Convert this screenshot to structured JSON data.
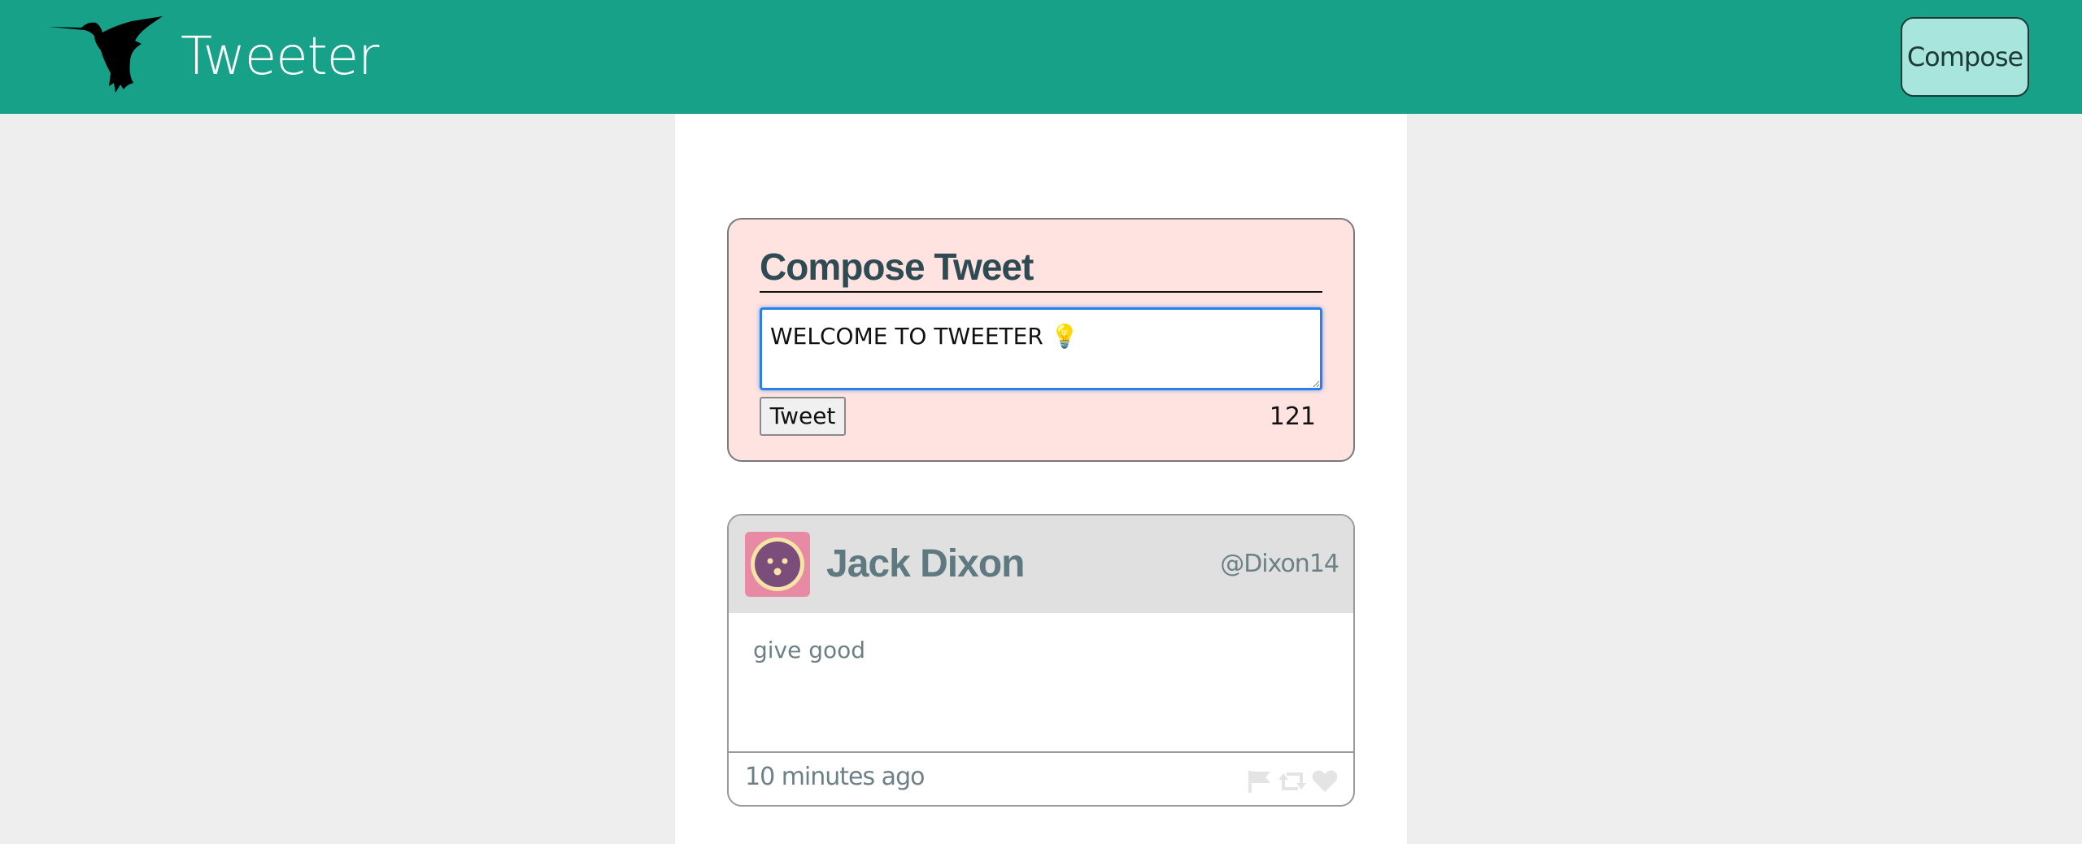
{
  "navbar": {
    "brand": "Tweeter",
    "compose_label": "Compose",
    "logo_icon": "hummingbird-icon"
  },
  "compose": {
    "title": "Compose Tweet",
    "input_value": "WELCOME TO TWEETER 💡",
    "submit_label": "Tweet",
    "counter": "121"
  },
  "tweet": {
    "avatar_icon": "avatar-icon",
    "name": "Jack Dixon",
    "handle": "@Dixon14",
    "content": "give good",
    "timestamp": "10 minutes ago",
    "actions": [
      "flag-icon",
      "retweet-icon",
      "heart-icon"
    ]
  },
  "colors": {
    "navbar": "#18a189",
    "compose_button": "#a8e6dd",
    "compose_box": "#ffe3e1",
    "tweet_header": "#e0e0e0",
    "page_background": "#eeeeee"
  }
}
